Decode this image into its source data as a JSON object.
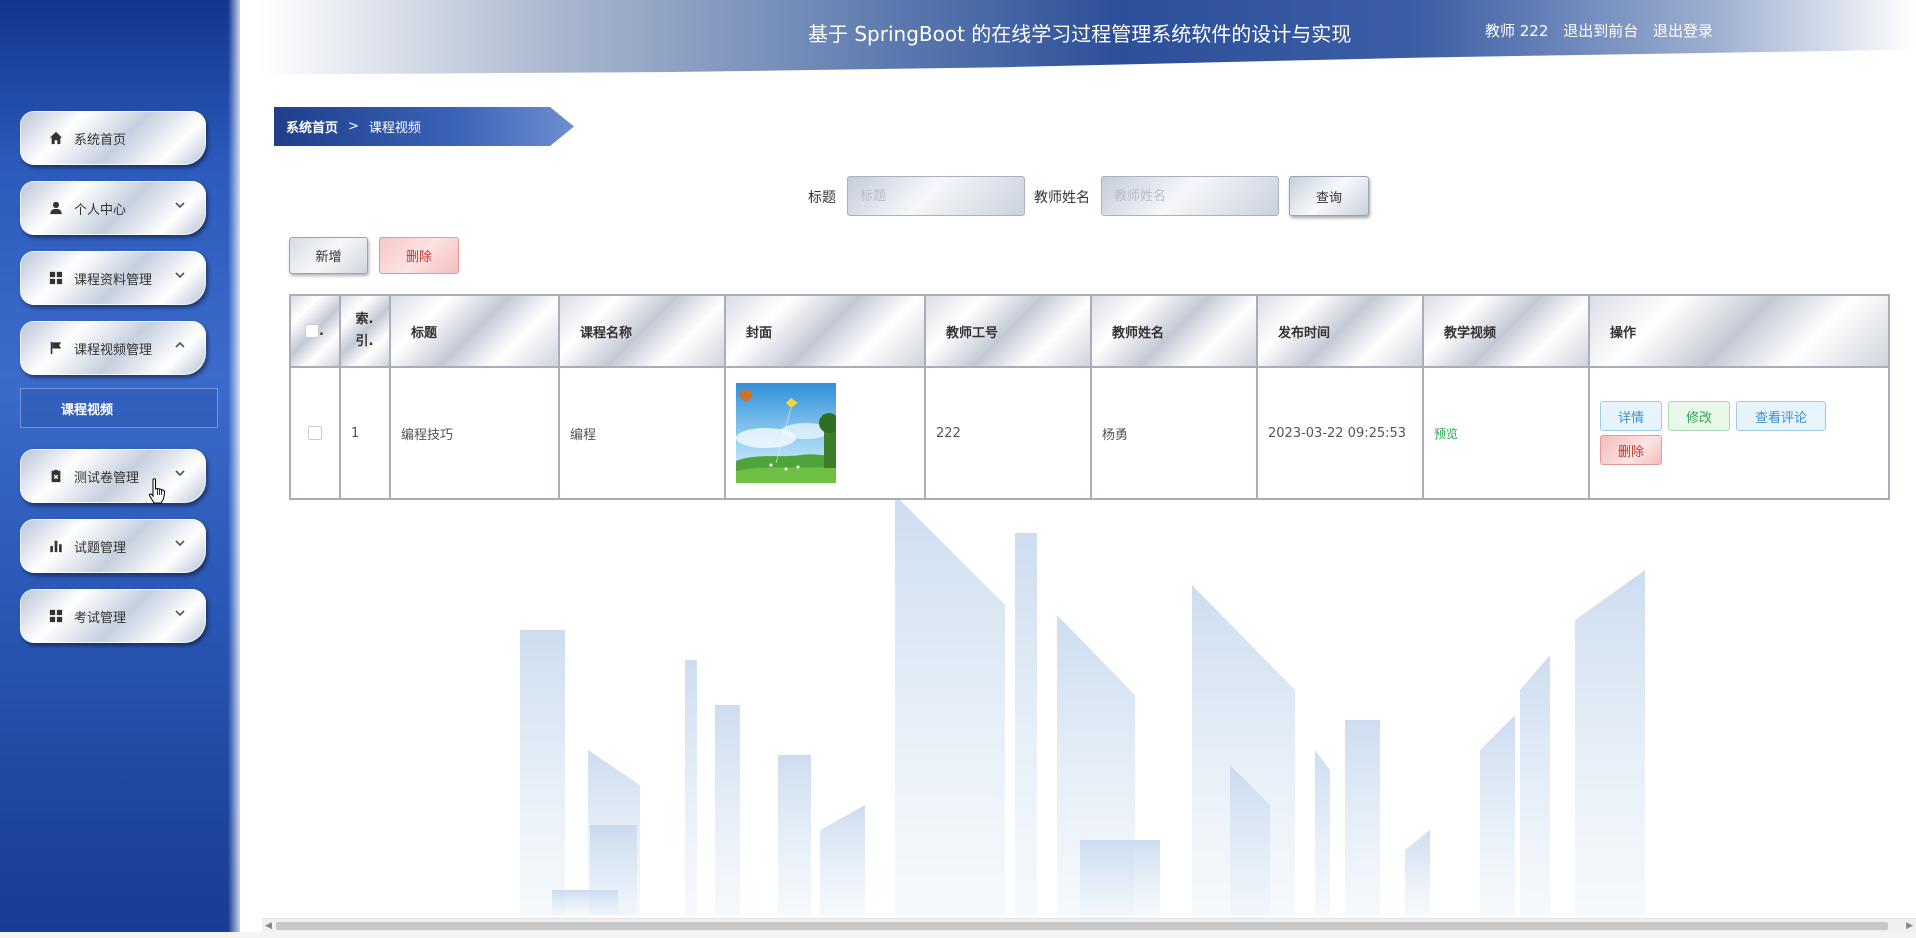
{
  "header": {
    "title": "基于 SpringBoot 的在线学习过程管理系统软件的设计与实现",
    "user": "教师 222",
    "front_link": "退出到前台",
    "logout_link": "退出登录"
  },
  "sidebar": {
    "items": [
      {
        "label": "系统首页",
        "icon": "home-icon"
      },
      {
        "label": "个人中心",
        "icon": "user-icon"
      },
      {
        "label": "课程资料管理",
        "icon": "grid-icon"
      },
      {
        "label": "课程视频管理",
        "icon": "flag-icon"
      },
      {
        "label": "测试卷管理",
        "icon": "clipboard-icon"
      },
      {
        "label": "试题管理",
        "icon": "bar-chart-icon"
      },
      {
        "label": "考试管理",
        "icon": "grid-icon"
      }
    ],
    "submenu_active": "课程视频"
  },
  "breadcrumb": {
    "home": "系统首页",
    "separator": ">",
    "current": "课程视频"
  },
  "search": {
    "title_label": "标题",
    "title_placeholder": "标题",
    "teacher_label": "教师姓名",
    "teacher_placeholder": "教师姓名",
    "query_button": "查询"
  },
  "actions": {
    "add": "新增",
    "delete": "删除"
  },
  "table": {
    "columns": [
      "索引",
      "标题",
      "课程名称",
      "封面",
      "教师工号",
      "教师姓名",
      "发布时间",
      "教学视频",
      "操作"
    ],
    "index_header_line1": "索.",
    "index_header_line2": "引.",
    "select_all_header": ".",
    "rows": [
      {
        "index": "1",
        "title": "编程技巧",
        "course": "编程",
        "teacher_id": "222",
        "teacher_name": "杨勇",
        "publish_time": "2023-03-22 09:25:53",
        "video": "预览"
      }
    ],
    "ops": {
      "detail": "详情",
      "edit": "修改",
      "comment": "查看评论",
      "delete": "删除"
    }
  },
  "colors": {
    "sidebar_blue": "#2d5bbd",
    "header_blue": "#2c4f99",
    "success_green": "#2aa64b",
    "info_blue": "#3a8fce",
    "danger_red": "#c0392b"
  }
}
